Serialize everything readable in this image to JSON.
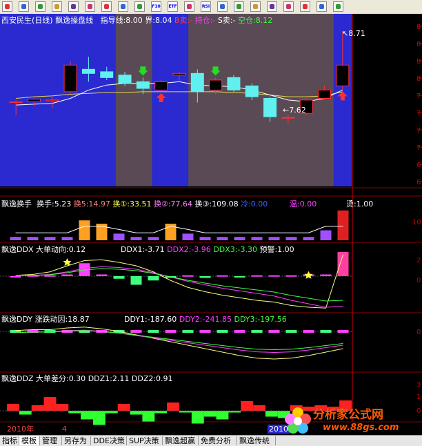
{
  "toolbar": {
    "icons": [
      "grid-icon",
      "line-chart-icon",
      "percent-icon",
      "candle-icon",
      "zoom-icon",
      "tools-icon",
      "people-icon",
      "moon-icon",
      "eye-icon",
      "f10-icon",
      "etf-icon",
      "news-icon",
      "rsi-icon",
      "calc-icon",
      "note-icon",
      "dollar-icon",
      "puzzle-icon",
      "pencil-icon",
      "move-icon",
      "up-arrow-icon",
      "down-arrow-icon"
    ],
    "labels": {
      "f10-icon": "F10",
      "etf-icon": "ETF",
      "rsi-icon": "RSI"
    }
  },
  "panels": {
    "main": {
      "title": "西安民生(日线)",
      "indicator": "飘逸操盘线",
      "guide": "指导线:8.00",
      "boundary": "界:8.04",
      "b_sell": "B卖:-",
      "hold": "持仓:-",
      "s_sell": "S卖:-",
      "empty": "空仓:8.12",
      "high_annot": "8.71",
      "low_annot": "7.62",
      "yticks": [
        "8",
        "8",
        "8",
        "8",
        "7",
        "7",
        "7",
        "7",
        "6",
        "6"
      ]
    },
    "turnover": {
      "name": "飘逸换手",
      "rate": "换手:5.23",
      "h5": "换5:14.97",
      "h1": "换①:33.51",
      "h2": "换②:77.64",
      "h3": "换③:109.08",
      "cold": "冷:0.00",
      "warm": "温:0.00",
      "hot": "烫:1.00",
      "yticks": [
        "10"
      ]
    },
    "ddx": {
      "name": "飘逸DDX",
      "dir": "大单动向:0.12",
      "ddx1": "DDX1:-3.71",
      "ddx2": "DDX2:-3.96",
      "ddx3": "DDX3:-3.30",
      "alert": "预警:1.00",
      "yticks": [
        "2",
        "0"
      ]
    },
    "ddy": {
      "name": "飘逸DDY",
      "dir": "涨跌动因:18.87",
      "ddy1": "DDY1:-187.60",
      "ddy2": "DDY2:-241.85",
      "ddy3": "DDY3:-197.56",
      "yticks": [
        "0"
      ]
    },
    "ddz": {
      "name": "飘逸DDZ",
      "dir": "大单差分:0.30",
      "ddz1": "DDZ1:2.11",
      "ddz2": "DDZ2:0.91",
      "yticks": [
        "3",
        "1",
        "0"
      ]
    }
  },
  "timeline": {
    "year_left": "2010年",
    "month_mark": "4",
    "year_right": "2010"
  },
  "tabs": [
    "指标",
    "模板",
    "管理",
    "另存为",
    "DDE决策",
    "SUP决策",
    "飘逸超赢",
    "免费分析",
    "飘逸传统"
  ],
  "active_tab": 1,
  "watermark": {
    "brand": "分析家公式网",
    "url": "www.88gs.com"
  },
  "colors": {
    "up": "#ff3030",
    "down": "#60f0f0",
    "panel_bg": "#2a2ad0",
    "shade": "#5a4a55"
  },
  "chart_data": {
    "type": "candlestick",
    "candles": [
      {
        "o": 7.85,
        "h": 7.88,
        "l": 7.7,
        "c": 7.86
      },
      {
        "o": 7.86,
        "h": 7.9,
        "l": 7.8,
        "c": 7.89
      },
      {
        "o": 7.87,
        "h": 7.92,
        "l": 7.78,
        "c": 7.88
      },
      {
        "o": 7.98,
        "h": 8.35,
        "l": 7.95,
        "c": 8.3
      },
      {
        "o": 8.25,
        "h": 8.4,
        "l": 8.1,
        "c": 8.2
      },
      {
        "o": 8.22,
        "h": 8.28,
        "l": 8.12,
        "c": 8.15
      },
      {
        "o": 8.18,
        "h": 8.22,
        "l": 8.05,
        "c": 8.08
      },
      {
        "o": 8.1,
        "h": 8.15,
        "l": 7.95,
        "c": 8.02
      },
      {
        "o": 8.0,
        "h": 8.12,
        "l": 7.98,
        "c": 8.1
      },
      {
        "o": 8.18,
        "h": 8.22,
        "l": 8.12,
        "c": 8.2
      },
      {
        "o": 8.2,
        "h": 8.25,
        "l": 7.85,
        "c": 7.98
      },
      {
        "o": 8.0,
        "h": 8.15,
        "l": 7.95,
        "c": 8.12
      },
      {
        "o": 8.15,
        "h": 8.18,
        "l": 7.98,
        "c": 8.0
      },
      {
        "o": 8.05,
        "h": 8.08,
        "l": 7.88,
        "c": 7.92
      },
      {
        "o": 7.9,
        "h": 7.92,
        "l": 7.62,
        "c": 7.68
      },
      {
        "o": 7.67,
        "h": 7.7,
        "l": 7.6,
        "c": 7.67
      },
      {
        "o": 7.72,
        "h": 7.9,
        "l": 7.7,
        "c": 7.88
      },
      {
        "o": 7.9,
        "h": 8.05,
        "l": 7.88,
        "c": 8.0
      },
      {
        "o": 8.05,
        "h": 8.71,
        "l": 8.0,
        "c": 8.3
      }
    ],
    "ma_white": [
      7.82,
      7.83,
      7.84,
      7.9,
      8.0,
      8.06,
      8.08,
      8.08,
      8.08,
      8.1,
      8.06,
      8.05,
      8.04,
      8.0,
      7.94,
      7.88,
      7.86,
      7.9,
      8.0
    ],
    "ma_yellow": [
      7.9,
      7.92,
      7.93,
      7.95,
      7.96,
      7.97,
      7.97,
      7.98,
      7.98,
      7.98,
      7.98,
      7.98,
      7.97,
      7.96,
      7.94,
      7.92,
      7.92,
      7.93,
      7.98
    ],
    "shaded_ranges": [
      [
        6,
        7
      ],
      [
        10,
        17
      ]
    ],
    "turnover": [
      1,
      1,
      1,
      1,
      6,
      5,
      2,
      1,
      1,
      5,
      2,
      1,
      1,
      1,
      1,
      1,
      1,
      1,
      3,
      9
    ],
    "ddx_hist": [
      0,
      0.1,
      0.1,
      0.2,
      1.5,
      0.2,
      -0.3,
      -1.0,
      -0.5,
      -0.2,
      0.1,
      -0.2,
      0.1,
      -0.1,
      0.1,
      0.1,
      0.1,
      0.2,
      0.2,
      2.8
    ],
    "ddx_line": [
      0.1,
      0.2,
      0.5,
      1.2,
      1.8,
      1.9,
      1.6,
      1.2,
      0.5,
      -0.5,
      -1.3,
      -1.8,
      -2.2,
      -2.5,
      -2.8,
      -3.0,
      -3.4,
      -3.6,
      -3.7,
      2.5
    ],
    "ddx_line2": [
      0.1,
      0.1,
      0.2,
      0.5,
      0.9,
      1.1,
      1.0,
      0.8,
      0.4,
      -0.1,
      -0.6,
      -1.0,
      -1.4,
      -1.7,
      -2.0,
      -2.3,
      -2.8,
      -3.2,
      -3.6,
      -3.5
    ],
    "ddz_vals": [
      1.0,
      -0.5,
      0.8,
      2.0,
      1.0,
      -0.3,
      -1.2,
      -2.0,
      -0.3,
      1.0,
      -0.5,
      -1.5,
      -0.3,
      1.2,
      -0.2,
      -1.8,
      -0.8,
      -1.2,
      -0.2,
      1.4,
      0.8,
      -0.8,
      -1.0,
      0.8,
      0.6,
      0.8,
      0.6,
      1.5
    ]
  }
}
